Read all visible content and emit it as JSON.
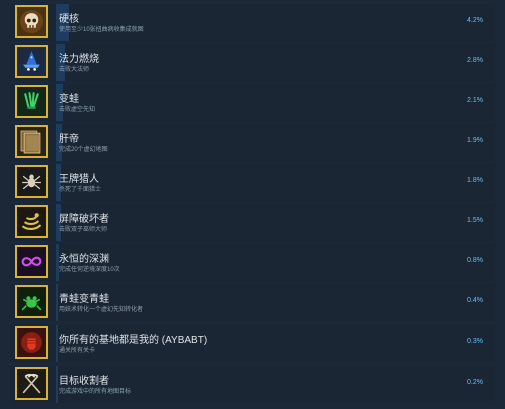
{
  "achievements": [
    {
      "icon": "skull-icon",
      "title": "硬核",
      "description": "使用至少10张扭曲病收集成就图",
      "percent": "4.2%"
    },
    {
      "icon": "wizard-hat-icon",
      "title": "法力燃烧",
      "description": "击败大法师",
      "percent": "2.8%"
    },
    {
      "icon": "claw-icon",
      "title": "变蛙",
      "description": "击败虚空先知",
      "percent": "2.1%"
    },
    {
      "icon": "stacked-cards-icon",
      "title": "肝帝",
      "description": "完成20个虚幻地图",
      "percent": "1.9%"
    },
    {
      "icon": "spider-icon",
      "title": "王牌猎人",
      "description": "杀死了千面猎士",
      "percent": "1.8%"
    },
    {
      "icon": "rope-coil-icon",
      "title": "屏障破坏者",
      "description": "击败双子巫师大师",
      "percent": "1.5%"
    },
    {
      "icon": "infinity-icon",
      "title": "永恒的深渊",
      "description": "完成任何逆境深度10次",
      "percent": "0.8%"
    },
    {
      "icon": "frog-icon",
      "title": "青蛙变青蛙",
      "description": "用妖术转化一个虚幻先知转化者",
      "percent": "0.4%"
    },
    {
      "icon": "red-fist-icon",
      "title": "你所有的基地都是我的 (AYBABT)",
      "description": "通关所有关卡",
      "percent": "0.3%"
    },
    {
      "icon": "crossed-scythes-icon",
      "title": "目标收割者",
      "description": "完成游戏中的所有地图目标",
      "percent": "0.2%"
    }
  ],
  "colors": {
    "background": "#1b2838",
    "row": "#1a2634",
    "progress": "#1e3c5e",
    "icon_border": "#d7b23c",
    "percent_text": "#66c0f4"
  }
}
